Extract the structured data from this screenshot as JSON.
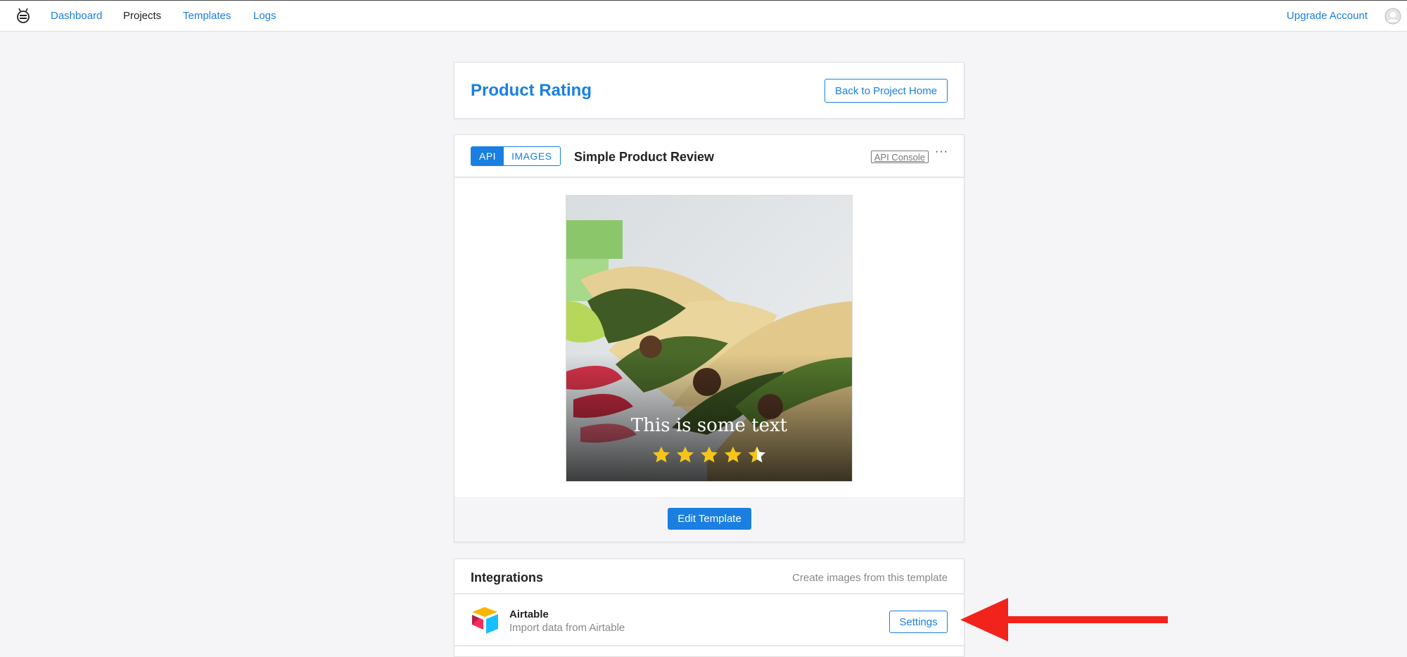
{
  "nav": {
    "links": [
      {
        "label": "Dashboard",
        "active": false
      },
      {
        "label": "Projects",
        "active": true
      },
      {
        "label": "Templates",
        "active": false
      },
      {
        "label": "Logs",
        "active": false
      }
    ],
    "upgrade_label": "Upgrade Account",
    "logo_icon": "bee-logo-icon",
    "avatar_icon": "user-avatar-icon"
  },
  "header": {
    "title": "Product Rating",
    "back_label": "Back to Project Home"
  },
  "template": {
    "tabs": [
      {
        "label": "API",
        "active": true
      },
      {
        "label": "IMAGES",
        "active": false
      }
    ],
    "name": "Simple Product Review",
    "api_console_label": "API Console",
    "more_label": "···",
    "preview": {
      "text": "This is some text",
      "rating": 4.5,
      "max_rating": 5
    },
    "edit_label": "Edit Template"
  },
  "integrations": {
    "title": "Integrations",
    "subtitle": "Create images from this template",
    "items": [
      {
        "name": "Airtable",
        "description": "Import data from Airtable",
        "button_label": "Settings",
        "icon": "airtable-logo-icon"
      }
    ]
  },
  "colors": {
    "accent": "#1a7fe0",
    "star": "#f5c518",
    "arrow": "#f2231b"
  }
}
